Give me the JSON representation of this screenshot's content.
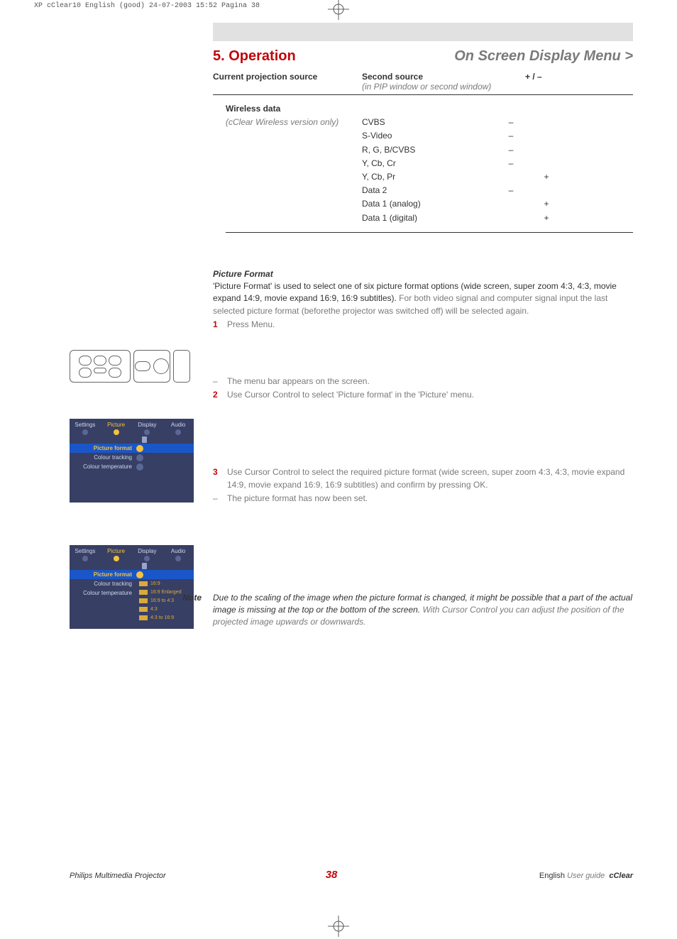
{
  "meta_header": "XP cClear10 English (good)  24-07-2003  15:52  Pagina 38",
  "title_left": "5. Operation",
  "title_right": "On Screen Display Menu >",
  "columns": {
    "col1": "Current projection source",
    "col2": "Second source",
    "col2_sub": "(in PIP window or second window)",
    "col3": "+ / –"
  },
  "wireless": {
    "title": "Wireless data",
    "sub": "(cClear Wireless version only)",
    "rows": [
      {
        "c2": "CVBS",
        "c3": "–",
        "c4": ""
      },
      {
        "c2": "S-Video",
        "c3": "–",
        "c4": ""
      },
      {
        "c2": "R, G, B/CVBS",
        "c3": "–",
        "c4": ""
      },
      {
        "c2": "Y, Cb, Cr",
        "c3": "–",
        "c4": ""
      },
      {
        "c2": "Y, Cb, Pr",
        "c3": "",
        "c4": "+"
      },
      {
        "c2": "Data 2",
        "c3": "–",
        "c4": ""
      },
      {
        "c2": "Data 1 (analog)",
        "c3": "",
        "c4": "+"
      },
      {
        "c2": "Data 1 (digital)",
        "c3": "",
        "c4": "+"
      }
    ]
  },
  "picture_format": {
    "heading": "Picture Format",
    "intro_black": "'Picture Format' is used to select one of six picture format options (wide screen, super zoom 4:3, 4:3, movie expand 14:9, movie expand 16:9, 16:9 subtitles). ",
    "intro_dim": "For both video signal and computer signal input the last selected picture format (beforethe projector was switched off) will be selected again.",
    "step1": "Press Menu.",
    "dash1": "The menu bar appears on the screen.",
    "step2": "Use Cursor Control to select 'Picture format' in the 'Picture' menu.",
    "step3": "Use Cursor Control to select the required picture format (wide screen, super zoom 4:3, 4:3, movie expand 14:9, movie expand 16:9, 16:9 subtitles) and confirm by pressing OK.",
    "dash2": "The picture format has now been set."
  },
  "osd": {
    "tabs": [
      "Settings",
      "Picture",
      "Display",
      "Audio"
    ],
    "items": [
      "Picture format",
      "Colour tracking",
      "Colour temperature"
    ],
    "submenu": [
      "16:9",
      "16:9 Enlarged",
      "16:9 to 4:3",
      "4:3",
      "4:3 to 16:9"
    ]
  },
  "note": {
    "label": "Note",
    "part1": "Due to the scaling of the image when the picture format is changed, it might be possible that a part of the actual image is missing at the top or the bottom of the screen. ",
    "part2": "With Cursor Control you can adjust the position of the projected image upwards or downwards."
  },
  "footer": {
    "left": "Philips Multimedia Projector",
    "page": "38",
    "english": "English",
    "userguide": "User guide",
    "product": "cClear"
  }
}
